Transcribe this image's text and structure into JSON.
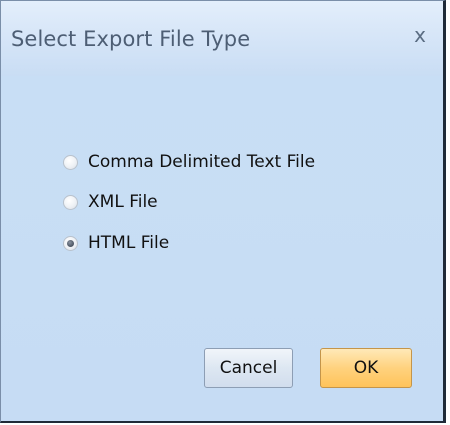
{
  "dialog": {
    "title": "Select Export File Type",
    "close_symbol": "x",
    "close_icon": "close-icon"
  },
  "options": [
    {
      "label": "Comma Delimited Text File",
      "selected": false
    },
    {
      "label": "XML File",
      "selected": false
    },
    {
      "label": "HTML File",
      "selected": true
    }
  ],
  "buttons": {
    "cancel_label": "Cancel",
    "ok_label": "OK"
  },
  "colors": {
    "dialog_background": "#c6dcf4",
    "ok_button": "#ffd27e",
    "cancel_button": "#dde7f2"
  }
}
